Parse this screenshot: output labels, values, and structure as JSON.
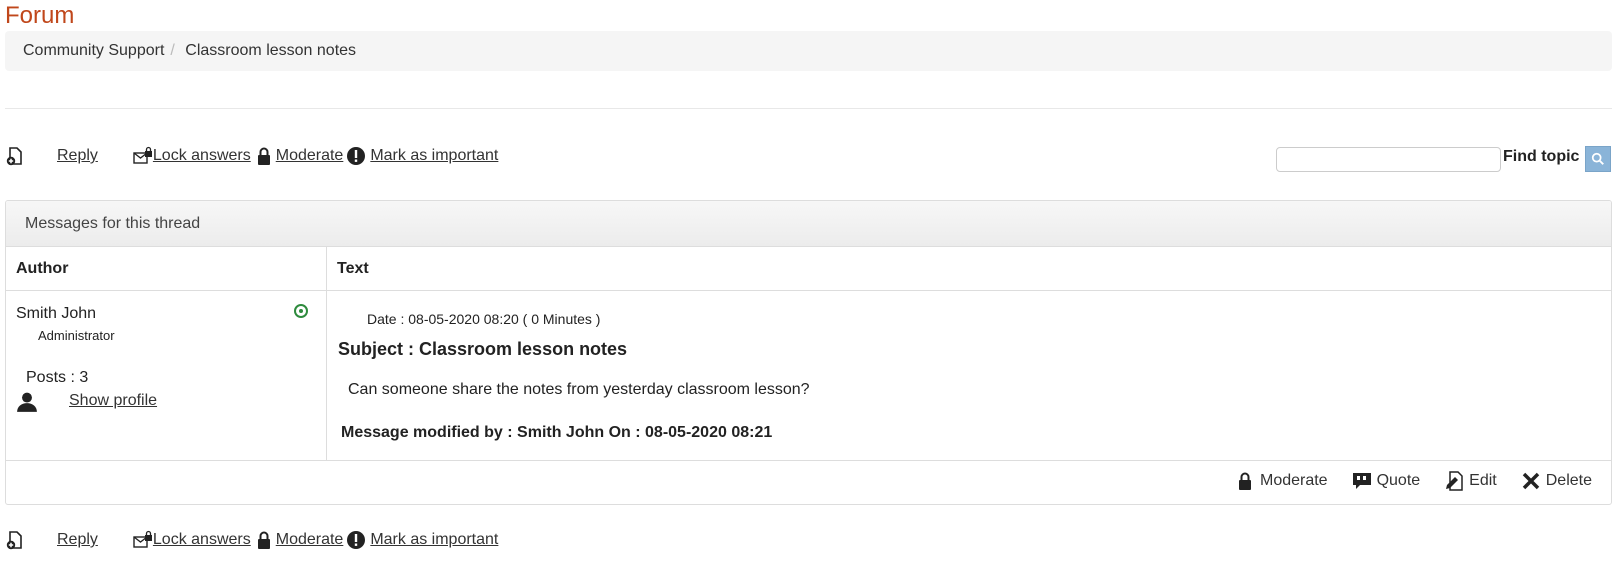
{
  "page": {
    "title": "Forum"
  },
  "breadcrumb": {
    "items": [
      "Community Support",
      "Classroom lesson notes"
    ]
  },
  "toolbar": {
    "reply": "Reply",
    "lock_answers": "Lock answers",
    "moderate": "Moderate",
    "mark_important": "Mark as important"
  },
  "search": {
    "label": "Find topic",
    "value": ""
  },
  "thread": {
    "heading": "Messages for this thread",
    "col_author": "Author",
    "col_text": "Text"
  },
  "post": {
    "author_name": "Smith John",
    "author_role": "Administrator",
    "posts_label": "Posts : 3",
    "show_profile": "Show profile",
    "date": "Date : 08-05-2020 08:20 ( 0 Minutes )",
    "subject": "Subject : Classroom lesson notes",
    "body": "Can someone share the notes from yesterday classroom lesson?",
    "modified": "Message modified by : Smith John On : 08-05-2020 08:21",
    "actions": {
      "moderate": "Moderate",
      "quote": "Quote",
      "edit": "Edit",
      "delete": "Delete"
    }
  },
  "colors": {
    "title": "#c0471b",
    "online": "#2e8b3d",
    "search_button": "#8ab4d8"
  },
  "icons": [
    "new-reply-icon",
    "lock-answers-icon",
    "lock-icon",
    "important-icon",
    "search-icon",
    "online-status-icon",
    "user-icon",
    "quote-icon",
    "edit-icon",
    "delete-icon"
  ]
}
